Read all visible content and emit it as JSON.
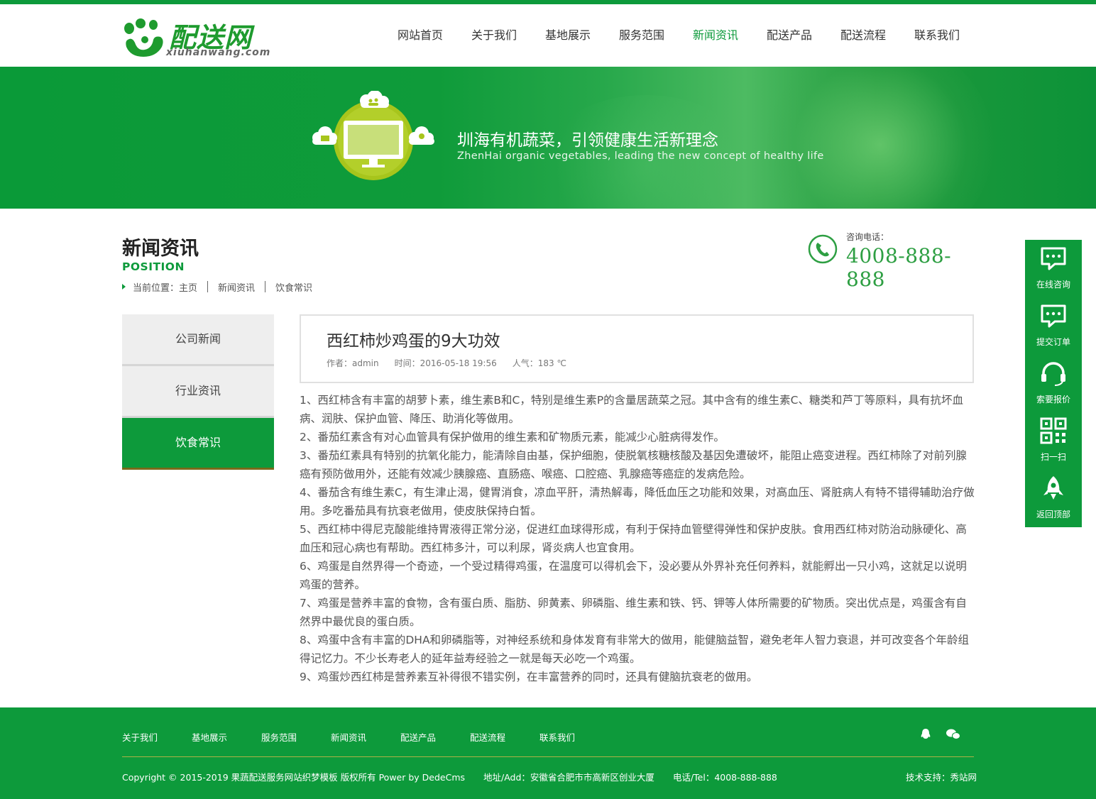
{
  "header": {
    "logo": {
      "brand": "配送网",
      "domain": "xiuhanwang.com"
    },
    "nav": [
      {
        "label": "网站首页",
        "active": false
      },
      {
        "label": "关于我们",
        "active": false
      },
      {
        "label": "基地展示",
        "active": false
      },
      {
        "label": "服务范围",
        "active": false
      },
      {
        "label": "新闻资讯",
        "active": true
      },
      {
        "label": "配送产品",
        "active": false
      },
      {
        "label": "配送流程",
        "active": false
      },
      {
        "label": "联系我们",
        "active": false
      }
    ]
  },
  "banner": {
    "slogan": "圳海有机蔬菜，引领健康生活新理念",
    "slogan_en": "ZhenHai organic vegetables, leading the new concept of healthy life"
  },
  "section": {
    "title": "新闻资讯",
    "subtitle": "POSITION",
    "breadcrumb": [
      "当前位置：主页",
      "新闻资讯",
      "饮食常识"
    ]
  },
  "contact": {
    "label": "咨询电话：",
    "phone": "4008-888-888"
  },
  "sidebar": {
    "items": [
      {
        "label": "公司新闻",
        "active": false
      },
      {
        "label": "行业资讯",
        "active": false
      },
      {
        "label": "饮食常识",
        "active": true
      }
    ]
  },
  "article": {
    "title": "西红柿炒鸡蛋的9大功效",
    "author": "作者：admin",
    "time": "时间：2016-05-18 19:56",
    "views": "人气：183 ℃",
    "paragraphs": [
      "1、西红柿含有丰富的胡萝卜素，维生素B和C，特别是维生素P的含量居蔬菜之冠。其中含有的维生素C、糖类和芦丁等原料，具有抗坏血病、润肤、保护血管、降压、助消化等做用。",
      "2、番茄红素含有对心血管具有保护做用的维生素和矿物质元素，能减少心脏病得发作。",
      "3、番茄红素具有特别的抗氧化能力，能清除自由基，保护细胞，使脱氧核糖核酸及基因免遭破坏，能阻止癌变进程。西红柿除了对前列腺癌有预防做用外，还能有效减少胰腺癌、直肠癌、喉癌、口腔癌、乳腺癌等癌症的发病危险。",
      "4、番茄含有维生素C，有生津止渴，健胃消食，凉血平肝，清热解毒，降低血压之功能和效果，对高血压、肾脏病人有特不错得辅助治疗做用。多吃番茄具有抗衰老做用，使皮肤保持白皙。",
      "5、西红柿中得尼克酸能维持胃液得正常分泌，促进红血球得形成，有利于保持血管壁得弹性和保护皮肤。食用西红柿对防治动脉硬化、高血压和冠心病也有帮助。西红柿多汁，可以利尿，肾炎病人也宜食用。",
      "6、鸡蛋是自然界得一个奇迹，一个受过精得鸡蛋，在温度可以得机会下，没必要从外界补充任何养料，就能孵出一只小鸡，这就足以说明鸡蛋的营养。",
      "7、鸡蛋是营养丰富的食物，含有蛋白质、脂肪、卵黄素、卵磷脂、维生素和铁、钙、钾等人体所需要的矿物质。突出优点是，鸡蛋含有自然界中最优良的蛋白质。",
      "8、鸡蛋中含有丰富的DHA和卵磷脂等，对神经系统和身体发育有非常大的做用，能健脑益智，避免老年人智力衰退，并可改变各个年龄组得记忆力。不少长寿老人的延年益寿经验之一就是每天必吃一个鸡蛋。",
      "9、鸡蛋炒西红柿是营养素互补得很不错实例，在丰富营养的同时，还具有健脑抗衰老的做用。"
    ]
  },
  "float_bar": {
    "items": [
      {
        "label": "在线咨询",
        "icon": "chat-icon"
      },
      {
        "label": "提交订单",
        "icon": "chat-icon"
      },
      {
        "label": "索要报价",
        "icon": "headset-icon"
      },
      {
        "label": "扫一扫",
        "icon": "qrcode-icon"
      },
      {
        "label": "返回顶部",
        "icon": "rocket-icon"
      }
    ]
  },
  "footer": {
    "nav": [
      "关于我们",
      "基地展示",
      "服务范围",
      "新闻资讯",
      "配送产品",
      "配送流程",
      "联系我们"
    ],
    "copyright": "Copyright © 2015-2019 果蔬配送服务网站织梦模板 版权所有 Power by DedeCms",
    "address": "地址/Add：安徽省合肥市市高新区创业大厦",
    "tel": "电话/Tel：4008-888-888",
    "tech": "技术支持：秀站网"
  },
  "colors": {
    "brand": "#0d9a3b",
    "accent_text": "#2e9f43"
  }
}
